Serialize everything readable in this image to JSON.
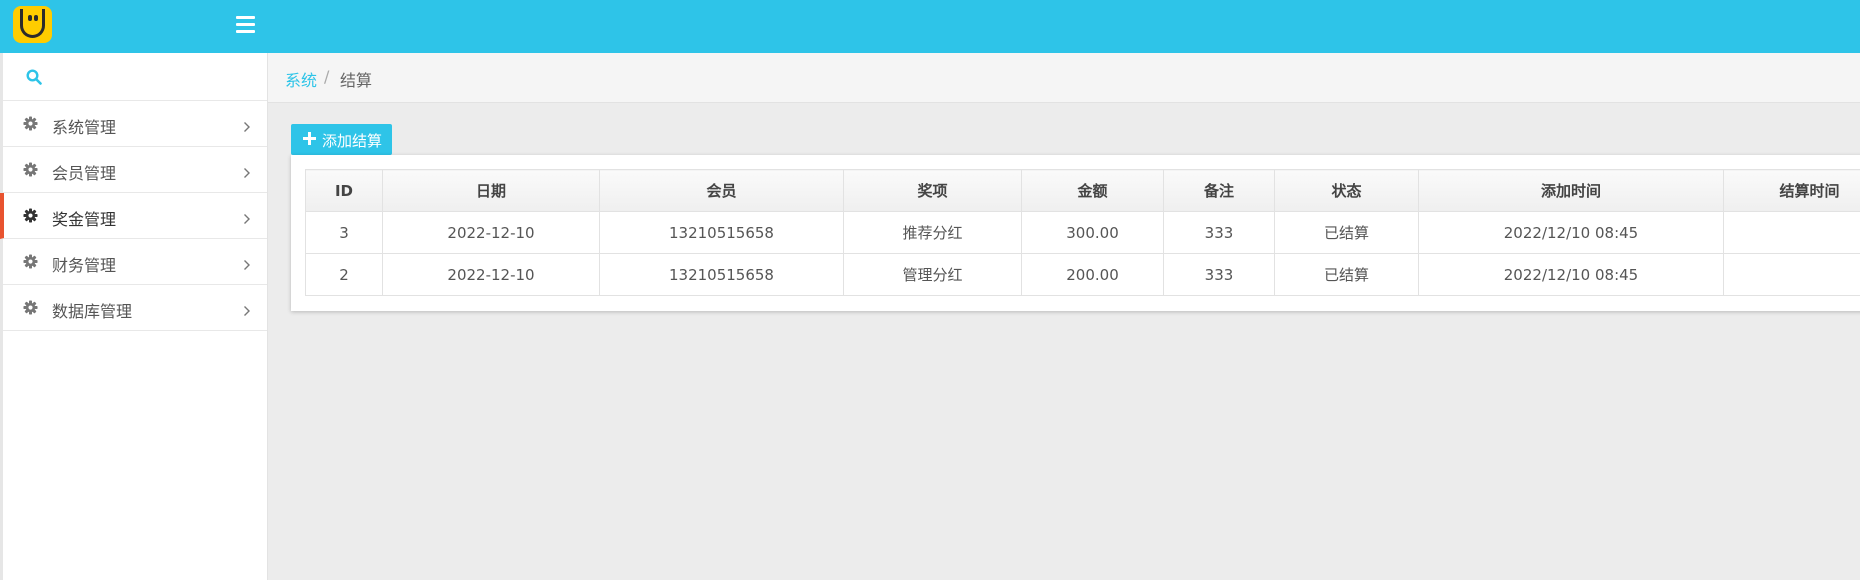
{
  "colors": {
    "accent": "#2ec4e8",
    "active_indicator": "#e8532f",
    "logo_bg": "#ffcc00"
  },
  "header": {
    "logo_icon": "smiley-logo-icon",
    "menu_icon": "hamburger-menu-icon"
  },
  "sidebar": {
    "search_icon": "search-icon",
    "items": [
      {
        "label": "系统管理",
        "icon": "gear-icon",
        "active": false
      },
      {
        "label": "会员管理",
        "icon": "gear-icon",
        "active": false
      },
      {
        "label": "奖金管理",
        "icon": "gear-icon",
        "active": true
      },
      {
        "label": "财务管理",
        "icon": "gear-icon",
        "active": false
      },
      {
        "label": "数据库管理",
        "icon": "gear-icon",
        "active": false
      }
    ]
  },
  "breadcrumb": {
    "root": "系统",
    "separator": "/",
    "current": "结算"
  },
  "toolbar": {
    "add_label": "添加结算",
    "add_icon": "plus-icon"
  },
  "table": {
    "columns": [
      "ID",
      "日期",
      "会员",
      "奖项",
      "金额",
      "备注",
      "状态",
      "添加时间",
      "结算时间"
    ],
    "rows": [
      [
        "3",
        "2022-12-10",
        "13210515658",
        "推荐分红",
        "300.00",
        "333",
        "已结算",
        "2022/12/10 08:45",
        ""
      ],
      [
        "2",
        "2022-12-10",
        "13210515658",
        "管理分红",
        "200.00",
        "333",
        "已结算",
        "2022/12/10 08:45",
        ""
      ]
    ]
  }
}
